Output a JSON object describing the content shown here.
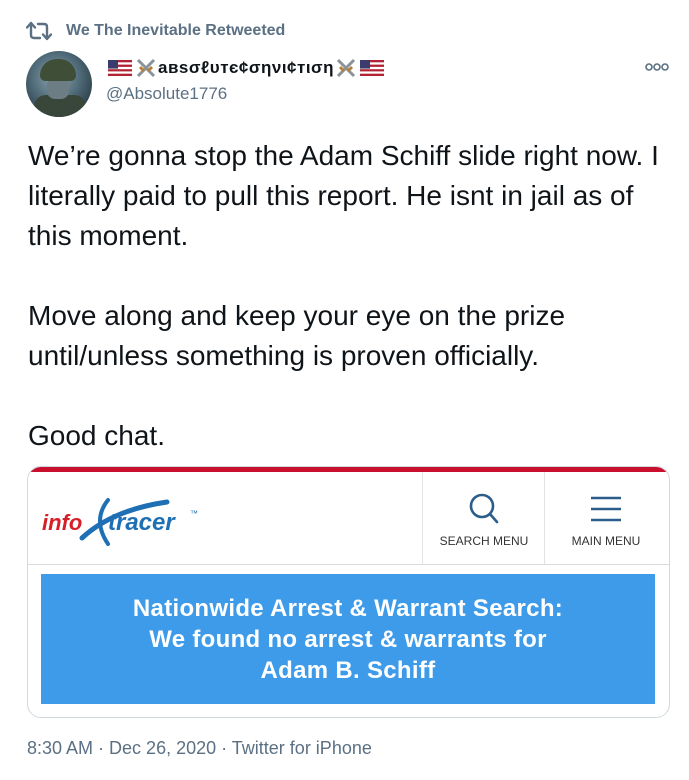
{
  "retweet": {
    "icon": "retweet-icon",
    "text": "We The Inevitable Retweeted"
  },
  "author": {
    "avatar": "avatar-image",
    "display_name_text": "авѕσℓυтє¢σηνι¢тιση",
    "name_decorations": [
      "us-flag-emoji",
      "crossed-swords-emoji",
      "crossed-swords-emoji",
      "us-flag-emoji"
    ],
    "handle": "@Absolute1776"
  },
  "more_menu_icon": "more-options-icon",
  "tweet": {
    "text": "We’re gonna stop the Adam Schiff slide right now. I literally paid to pull this report. He isnt in jail as of this moment.\n\nMove along and keep your eye on the prize until/unless something is proven officially.\n\nGood chat."
  },
  "card": {
    "logo_part1": "info",
    "logo_part2": "tracer",
    "logo_tm": "™",
    "search_label": "SEARCH MENU",
    "menu_label": "MAIN MENU",
    "banner_lines": [
      "Nationwide Arrest & Warrant Search:",
      "We found no arrest & warrants for",
      "Adam B. Schiff"
    ],
    "colors": {
      "banner": "#3d9be9",
      "topline": "#c8102e",
      "logo_red": "#d62027",
      "logo_blue": "#1f6fb5"
    }
  },
  "meta": {
    "time": "8:30 AM",
    "sep1": " · ",
    "date": "Dec 26, 2020",
    "sep2": " · ",
    "source": "Twitter for iPhone"
  }
}
